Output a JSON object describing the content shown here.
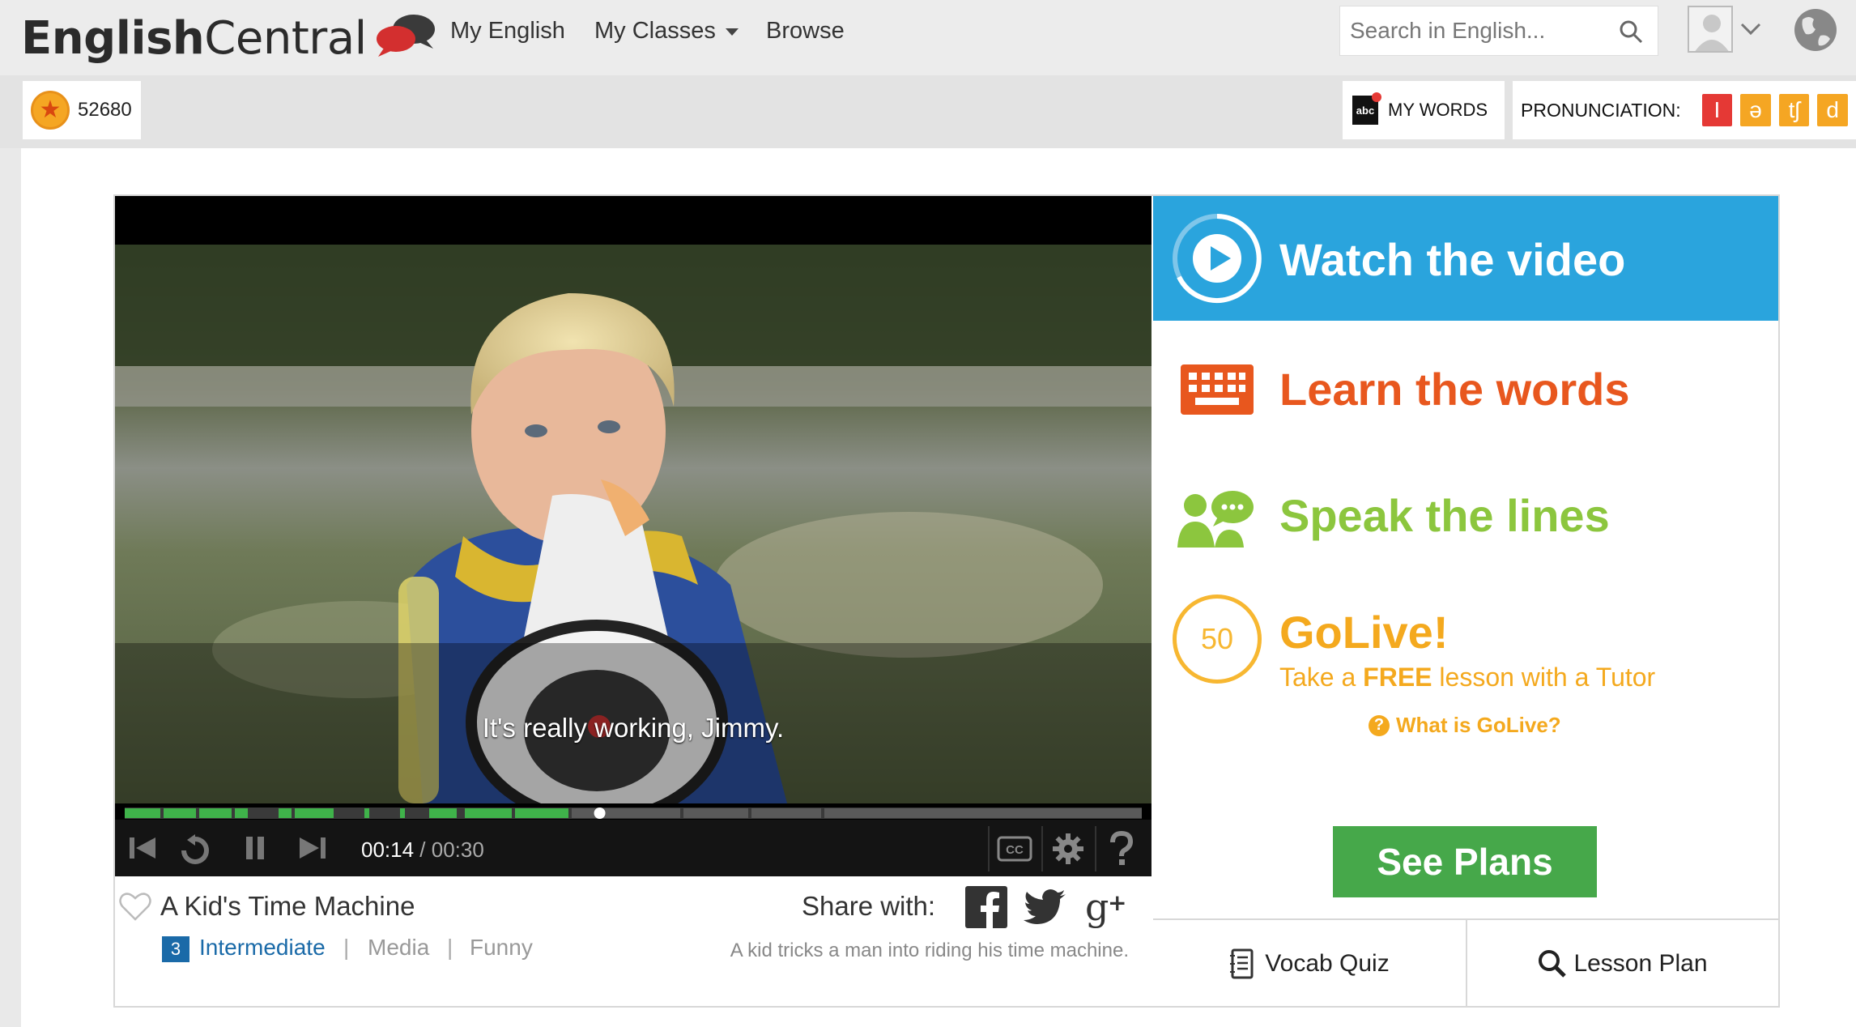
{
  "header": {
    "logo_text_bold": "English",
    "logo_text_light": "Central",
    "nav": {
      "my_english": "My English",
      "my_classes": "My Classes",
      "browse": "Browse"
    },
    "search_placeholder": "Search in English..."
  },
  "toolbar": {
    "points": "52680",
    "my_words_icon_text": "abc",
    "my_words": "MY WORDS",
    "pronunciation_label": "PRONUNCIATION:",
    "pronunciation_symbols": [
      "I",
      "ə",
      "tʃ",
      "d"
    ],
    "pronunciation_colors": [
      "#e53935",
      "#f5a623",
      "#f5a623",
      "#f5a623"
    ]
  },
  "video": {
    "subtitle": "It's really working, Jimmy.",
    "progress": 0.467,
    "current_time": "00:14",
    "separator": " / ",
    "total_time": "00:30",
    "cc_label": "CC"
  },
  "video_info": {
    "title": "A Kid's Time Machine",
    "level_number": "3",
    "level_name": "Intermediate",
    "separator": "|",
    "categories": [
      "Media",
      "Funny"
    ],
    "share_label": "Share with:",
    "description": "A kid tricks a man into riding his time machine."
  },
  "steps": {
    "watch": "Watch the video",
    "learn": "Learn the words",
    "speak": "Speak the lines",
    "golive_count": "50",
    "golive_title": "GoLive!",
    "golive_sub_pre": "Take a ",
    "golive_sub_bold": "FREE",
    "golive_sub_post": " lesson with a Tutor",
    "golive_help_icon": "?",
    "golive_help": "What is GoLive?",
    "see_plans": "See Plans",
    "vocab_quiz": "Vocab Quiz",
    "lesson_plan": "Lesson Plan"
  },
  "colors": {
    "watch": "#2aa4dd",
    "learn": "#e8571e",
    "speak": "#8cc63e",
    "golive": "#f4a91e",
    "see_plans": "#46a84a",
    "level": "#1a6aa8"
  }
}
